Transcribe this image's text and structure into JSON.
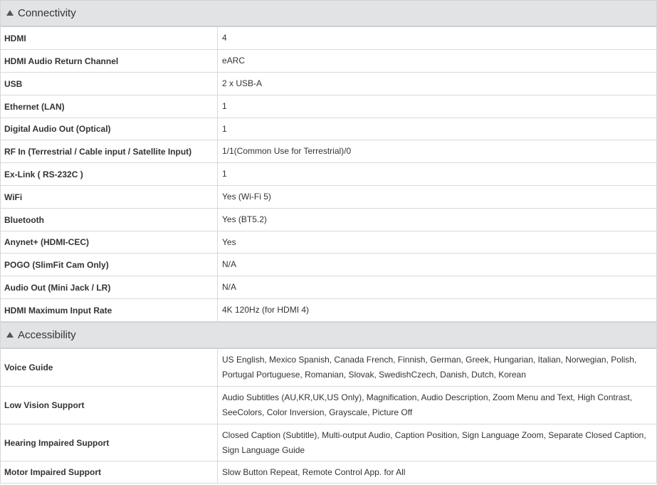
{
  "sections": [
    {
      "title": "Connectivity",
      "rows": [
        {
          "label": "HDMI",
          "value": "4"
        },
        {
          "label": "HDMI Audio Return Channel",
          "value": "eARC"
        },
        {
          "label": "USB",
          "value": "2 x USB-A"
        },
        {
          "label": "Ethernet (LAN)",
          "value": "1"
        },
        {
          "label": "Digital Audio Out (Optical)",
          "value": "1"
        },
        {
          "label": "RF In (Terrestrial / Cable input / Satellite Input)",
          "value": "1/1(Common Use for Terrestrial)/0"
        },
        {
          "label": "Ex-Link ( RS-232C )",
          "value": "1"
        },
        {
          "label": "WiFi",
          "value": "Yes (Wi-Fi 5)"
        },
        {
          "label": "Bluetooth",
          "value": "Yes (BT5.2)"
        },
        {
          "label": "Anynet+ (HDMI-CEC)",
          "value": "Yes"
        },
        {
          "label": "POGO (SlimFit Cam Only)",
          "value": "N/A"
        },
        {
          "label": "Audio Out (Mini Jack / LR)",
          "value": "N/A"
        },
        {
          "label": "HDMI Maximum Input Rate",
          "value": "4K 120Hz (for HDMI 4)"
        }
      ]
    },
    {
      "title": "Accessibility",
      "rows": [
        {
          "label": "Voice Guide",
          "value": "US English, Mexico Spanish, Canada French, Finnish, German, Greek, Hungarian, Italian, Norwegian, Polish, Portugal Portuguese, Romanian, Slovak, SwedishCzech, Danish, Dutch, Korean"
        },
        {
          "label": "Low Vision Support",
          "value": "Audio Subtitles (AU,KR,UK,US Only), Magnification, Audio Description, Zoom Menu and Text, High Contrast, SeeColors, Color Inversion, Grayscale, Picture Off"
        },
        {
          "label": "Hearing Impaired Support",
          "value": "Closed Caption (Subtitle), Multi-output Audio, Caption Position, Sign Language Zoom, Separate Closed Caption, Sign Language Guide"
        },
        {
          "label": "Motor Impaired Support",
          "value": "Slow Button Repeat, Remote Control App. for All"
        }
      ]
    }
  ],
  "icons": {
    "collapse": "triangle-up-icon"
  }
}
